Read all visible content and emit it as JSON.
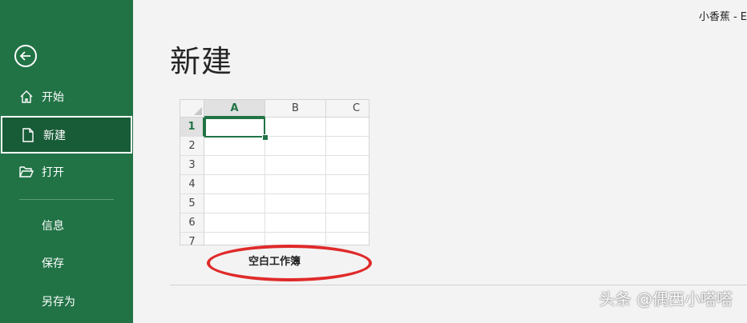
{
  "header": {
    "user": "小香蕉 - E"
  },
  "sidebar": {
    "items": [
      {
        "label": "开始",
        "icon": "home-icon"
      },
      {
        "label": "新建",
        "icon": "new-document-icon",
        "active": true
      },
      {
        "label": "打开",
        "icon": "folder-open-icon"
      },
      {
        "label": "信息"
      },
      {
        "label": "保存"
      },
      {
        "label": "另存为"
      }
    ]
  },
  "main": {
    "title": "新建",
    "template": {
      "label": "空白工作簿",
      "columns": [
        "A",
        "B",
        "C"
      ],
      "rows": [
        "1",
        "2",
        "3",
        "4",
        "5",
        "6",
        "7"
      ]
    }
  },
  "watermark": "头条 @偶西小嗒嗒",
  "colors": {
    "accent": "#217346",
    "highlight": "#e02a2a"
  }
}
